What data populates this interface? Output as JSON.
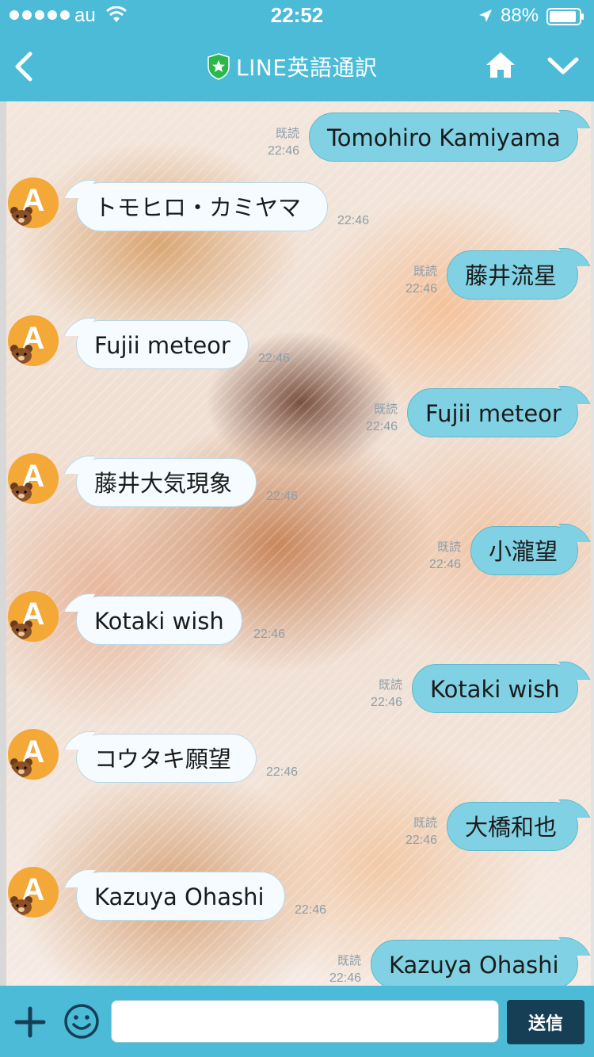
{
  "status_bar": {
    "carrier": "au",
    "time": "22:52",
    "battery": "88%"
  },
  "header": {
    "title": "LINE英語通訳",
    "icons": [
      "back-chevron-icon",
      "verified-shield-icon",
      "home-icon",
      "chevron-down-icon"
    ]
  },
  "messages": [
    {
      "side": "out",
      "text": "Tomohiro Kamiyama",
      "read": "既読",
      "time": "22:46"
    },
    {
      "side": "in",
      "text": "トモヒロ・カミヤマ",
      "time": "22:46",
      "avatar": "A"
    },
    {
      "side": "out",
      "text": "藤井流星",
      "read": "既読",
      "time": "22:46"
    },
    {
      "side": "in",
      "text": "Fujii meteor",
      "time": "22:46",
      "avatar": "A"
    },
    {
      "side": "out",
      "text": "Fujii meteor",
      "read": "既読",
      "time": "22:46"
    },
    {
      "side": "in",
      "text": "藤井大気現象",
      "time": "22:46",
      "avatar": "A"
    },
    {
      "side": "out",
      "text": "小瀧望",
      "read": "既読",
      "time": "22:46"
    },
    {
      "side": "in",
      "text": "Kotaki wish",
      "time": "22:46",
      "avatar": "A"
    },
    {
      "side": "out",
      "text": "Kotaki wish",
      "read": "既読",
      "time": "22:46"
    },
    {
      "side": "in",
      "text": "コウタキ願望",
      "time": "22:46",
      "avatar": "A"
    },
    {
      "side": "out",
      "text": "大橋和也",
      "read": "既読",
      "time": "22:46"
    },
    {
      "side": "in",
      "text": "Kazuya Ohashi",
      "time": "22:46",
      "avatar": "A"
    },
    {
      "side": "out",
      "text": "Kazuya Ohashi",
      "read": "既読",
      "time": "22:46"
    }
  ],
  "input_bar": {
    "message_value": "",
    "send_label": "送信",
    "icons": [
      "plus-icon",
      "emoji-icon"
    ]
  },
  "colors": {
    "header_bg": "#4bbbd8",
    "outgoing_bubble": "#80d1e3",
    "incoming_bubble": "#f5fbff",
    "send_button": "#163e54",
    "avatar": "#f3a838"
  }
}
